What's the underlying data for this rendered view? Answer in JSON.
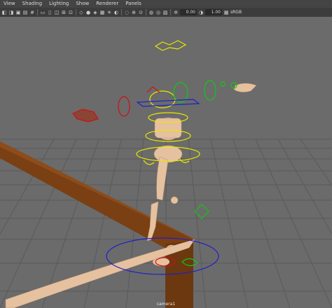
{
  "menubar": {
    "items": [
      "View",
      "Shading",
      "Lighting",
      "Show",
      "Renderer",
      "Panels"
    ]
  },
  "toolbar": {
    "field1": "0.00",
    "field2": "1.00",
    "colorspace": "sRGB"
  },
  "viewport": {
    "camera_label": "camera1"
  },
  "colors": {
    "background": "#6b6b6b",
    "grid": "#5c5c5c",
    "wood": "#7a3f12",
    "skin": "#e6c1a0",
    "yellow": "#e8e800",
    "green": "#10c810",
    "red": "#d01010",
    "blue": "#2020c8"
  }
}
